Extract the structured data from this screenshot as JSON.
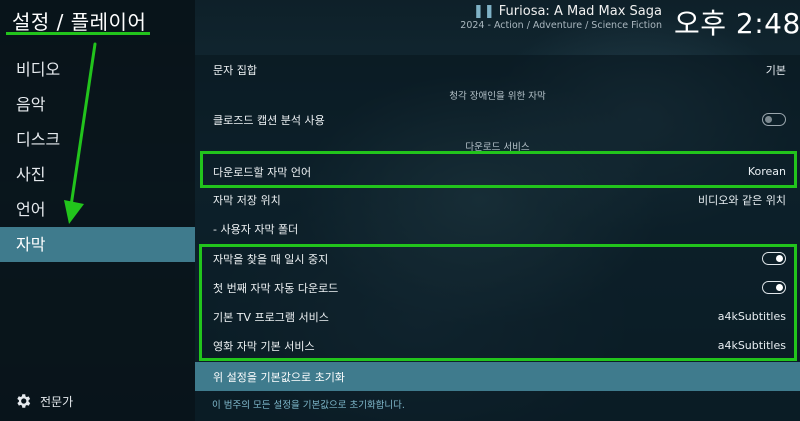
{
  "header": {
    "breadcrumb": "설정 / 플레이어",
    "movie_title": "Furiosa: A Mad Max Saga",
    "movie_subtitle": "2024 - Action / Adventure / Science Fiction",
    "clock": "오후 2:48"
  },
  "sidebar": {
    "items": [
      {
        "label": "비디오"
      },
      {
        "label": "음악"
      },
      {
        "label": "디스크"
      },
      {
        "label": "사진"
      },
      {
        "label": "언어"
      },
      {
        "label": "자막",
        "active": true
      }
    ],
    "expert_label": "전문가",
    "expert_icon": "gear-icon"
  },
  "settings": {
    "charset": {
      "label": "문자 집합",
      "value": "기본"
    },
    "hearing_section": "청각 장애인을 위한 자막",
    "closed_caption": {
      "label": "클로즈드 캡션 분석 사용",
      "toggle": "off"
    },
    "download_section": "다운로드 서비스",
    "download_language": {
      "label": "다운로드할 자막 언어",
      "value": "Korean"
    },
    "storage_location": {
      "label": "자막 저장 위치",
      "value": "비디오와 같은 위치"
    },
    "custom_folder": {
      "label": "- 사용자 자막 폴더"
    },
    "pause_when_searching": {
      "label": "자막을 찾을 때 일시 중지",
      "toggle": "on"
    },
    "auto_download_first": {
      "label": "첫 번째 자막 자동 다운로드",
      "toggle": "on"
    },
    "default_tv_service": {
      "label": "기본 TV 프로그램 서비스",
      "value": "a4kSubtitles"
    },
    "default_movie_service": {
      "label": "영화 자막 기본 서비스",
      "value": "a4kSubtitles"
    },
    "reset": {
      "label": "위 설정을 기본값으로 초기화"
    },
    "reset_description": "이 범주의 모든 설정을 기본값으로 초기화합니다."
  },
  "colors": {
    "highlight": "#3f7b8d",
    "annotation_green": "#22c41c"
  }
}
